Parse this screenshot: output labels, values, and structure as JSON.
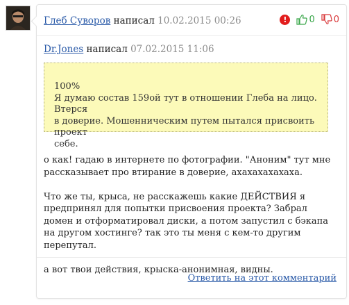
{
  "comment": {
    "author": "Глеб Суворов",
    "verb": "написал",
    "timestamp": "10.02.2015 00:26",
    "report_glyph": "!",
    "up_count": "0",
    "down_count": "0",
    "quote": {
      "author": "Dr.Jones",
      "verb": "написал",
      "timestamp": "07.02.2015 11:06",
      "lines": [
        "100%",
        "Я думаю состав 159ой тут в отношении Глеба на лицо. Втерся",
        "в доверие. Мошенническим путем пытался присвоить проект",
        "себе."
      ]
    },
    "paragraphs": [
      "о как! гадаю в интернете по фотографии. \"Аноним\" тут мне рассказывает про втирание в доверие, ахахахахахаха.",
      "Что же ты, крыса, не расскажешь какие ДЕЙСТВИЯ я предпринял для попытки присвоения проекта? Забрал домен и отформатировал диски, а потом запустил с бэкапа на другом хостинге? так это ты меня с кем-то другим перепутал.",
      "а вот твои действия, крыска-анонимная, видны."
    ],
    "reply_label": "Ответить на этот комментарий"
  },
  "icons": {
    "report": "report-icon",
    "thumb_up": "thumb-up-icon",
    "thumb_down": "thumb-down-icon"
  },
  "colors": {
    "link": "#2a5aa8",
    "quote_background": "#fcfab9",
    "upvote": "#3aa64a",
    "downvote": "#d9383a",
    "report": "#e21c1c"
  }
}
